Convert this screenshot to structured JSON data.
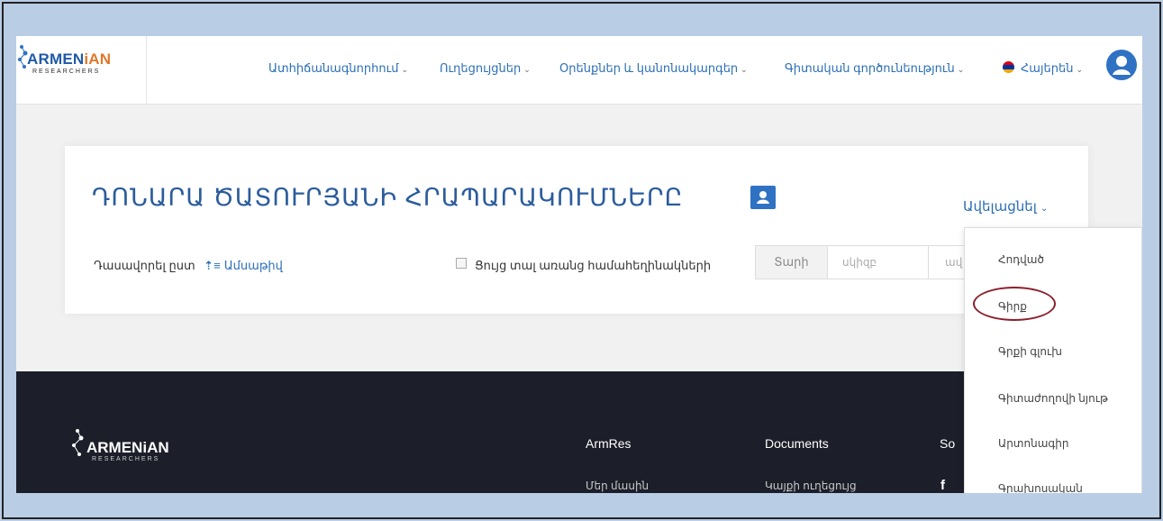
{
  "logo": {
    "name_part1": "ARMEN",
    "name_part2": "iAN",
    "subtitle": "RESEARCHERS"
  },
  "nav": {
    "items": [
      {
        "label": "Ատհիճանագնորհում",
        "caret": "⌄"
      },
      {
        "label": "Ուղեցույցներ",
        "caret": "⌄"
      },
      {
        "label": "Օրենքներ և կանոնակարգեր",
        "caret": "⌄"
      },
      {
        "label": "Գիտական գործունեություն",
        "caret": "⌄"
      }
    ],
    "language": "Հայերեն",
    "language_caret": "⌄",
    "flag_colors": [
      "#d90012",
      "#0033a0",
      "#f2a800"
    ]
  },
  "page": {
    "title": "ԴՈՆԱՐԱ ԾԱՏՈՒՐՅԱՆԻ ՀՐԱՊԱՐԱԿՈՒՄՆԵՐԸ",
    "add_button": "Ավելացնել",
    "add_caret": "⌄",
    "sort_label": "Դասավորել ըստ",
    "sort_value": "Ամսաթիվ",
    "show_without_coauthors": "Ցույց տալ առանց համահեղինակների",
    "year_label": "Տարի",
    "year_from_placeholder": "սկիզբ",
    "year_to_placeholder": "ավ"
  },
  "dropdown": {
    "items": [
      "Հոդված",
      "Գիրք",
      "Գրքի գլուխ",
      "Գիտաժողովի նյութ",
      "Արտոնագիր",
      "Գրախոսական"
    ]
  },
  "footer": {
    "logo_part1": "ARMEN",
    "logo_part2": "iAN",
    "logo_subtitle": "RESEARCHERS",
    "col1_title": "ArmRes",
    "col1_link": "Մեր մասին",
    "col2_title": "Documents",
    "col2_link": "Կայքի ուղեցույց",
    "col3_title": "So",
    "facebook_glyph": "f"
  },
  "colors": {
    "accent": "#2b6fb5",
    "brand_orange": "#e0772a",
    "footer_bg": "#1c1f2a",
    "annotation": "#8b1f2c",
    "frame_bg": "#b9cde5"
  }
}
